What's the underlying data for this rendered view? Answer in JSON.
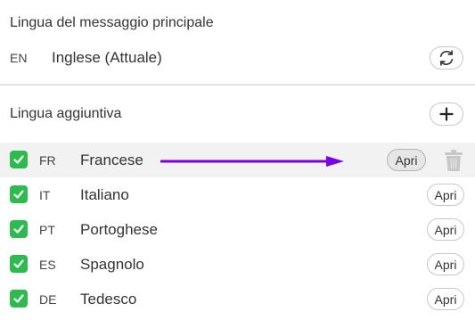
{
  "primary": {
    "title": "Lingua del messaggio principale",
    "code": "EN",
    "name": "Inglese (Attuale)",
    "refresh_icon": "refresh-icon"
  },
  "additional": {
    "title": "Lingua aggiuntiva",
    "add_icon": "plus-icon"
  },
  "languages": [
    {
      "code": "FR",
      "name": "Francese",
      "checked": true,
      "open_label": "Apri"
    },
    {
      "code": "IT",
      "name": "Italiano",
      "checked": true,
      "open_label": "Apri"
    },
    {
      "code": "PT",
      "name": "Portoghese",
      "checked": true,
      "open_label": "Apri"
    },
    {
      "code": "ES",
      "name": "Spagnolo",
      "checked": true,
      "open_label": "Apri"
    },
    {
      "code": "DE",
      "name": "Tedesco",
      "checked": true,
      "open_label": "Apri"
    }
  ],
  "colors": {
    "checkbox": "#2dba4e",
    "annotation_arrow": "#7a00e6",
    "row_highlight": "#f2f2f2"
  },
  "icons": {
    "checkbox": "checkmark-icon",
    "delete": "trash-icon",
    "annotation": "arrow-right-icon"
  }
}
